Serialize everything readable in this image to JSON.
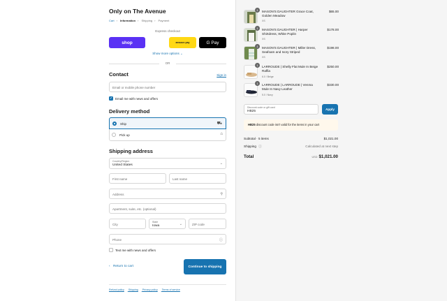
{
  "store": {
    "name": "Only on The Avenue"
  },
  "breadcrumbs": [
    "Cart",
    "Information",
    "Shipping",
    "Payment"
  ],
  "express": {
    "label": "Express checkout",
    "shop_label": "shop",
    "amazon_label": "amazon pay",
    "gpay_label": "G Pay",
    "more_options": "Show more options ⌄",
    "or": "OR"
  },
  "contact": {
    "heading": "Contact",
    "sign_in": "Sign in",
    "placeholder": "Email or mobile phone number",
    "newsletter_label": "Email me with news and offers",
    "newsletter_checked": true
  },
  "delivery": {
    "heading": "Delivery method",
    "options": [
      {
        "label": "Ship",
        "selected": true,
        "icon": "truck-icon"
      },
      {
        "label": "Pick up",
        "selected": false,
        "icon": "store-icon"
      }
    ]
  },
  "shipping": {
    "heading": "Shipping address",
    "country_label": "Country/Region",
    "country_value": "United States",
    "first_name": "First name",
    "last_name": "Last name",
    "address": "Address",
    "apartment": "Apartment, suite, etc. (optional)",
    "city": "City",
    "state_label": "State",
    "state_value": "Iowa",
    "zip": "ZIP code",
    "phone": "Phone",
    "sms_label": "Text me with news and offers"
  },
  "actions": {
    "back": "Return to cart",
    "continue": "Continue to shipping"
  },
  "footer": [
    "Refund policy",
    "Shipping",
    "Privacy policy",
    "Terms of service"
  ],
  "cart": {
    "items": [
      {
        "name": "MASON'S DAUGHTER Grace Coat, Golden Meadow",
        "variant": "XS",
        "price": "$65.00",
        "qty": "1"
      },
      {
        "name": "MASON'S DAUGHTER | Harper Shirtdress, White Poplin",
        "variant": "XS",
        "price": "$178.00",
        "qty": "1"
      },
      {
        "name": "MASON'S DAUGHTER | Miller Dress, Seafoam and Ivory Striped",
        "variant": "XS",
        "price": "$198.00",
        "qty": "1"
      },
      {
        "name": "LARROUDE | Shelly Flat Mule In Beige Raffia",
        "variant": "6.0 / Beige",
        "price": "$250.00",
        "qty": "1"
      },
      {
        "name": "LARROUDE | LARROUDE | Venma Mule In Navy Leather",
        "variant": "5.0 / Navy",
        "price": "$330.00",
        "qty": "1"
      }
    ],
    "discount_label": "Discount code or gift card",
    "discount_value": "HB25",
    "apply": "Apply",
    "warning_code": "HB25",
    "warning_text": " discount code isn't valid for the items in your cart",
    "subtotal_label": "Subtotal · 5 items",
    "subtotal_value": "$1,021.00",
    "shipping_label": "Shipping",
    "shipping_value": "Calculated at next step",
    "total_label": "Total",
    "total_currency": "USD",
    "total_value": "$1,021.00"
  },
  "colors": {
    "accent": "#1773b0",
    "shop": "#5a31f4",
    "amazon": "#ffd814",
    "warning_bg": "#fff8ec"
  }
}
